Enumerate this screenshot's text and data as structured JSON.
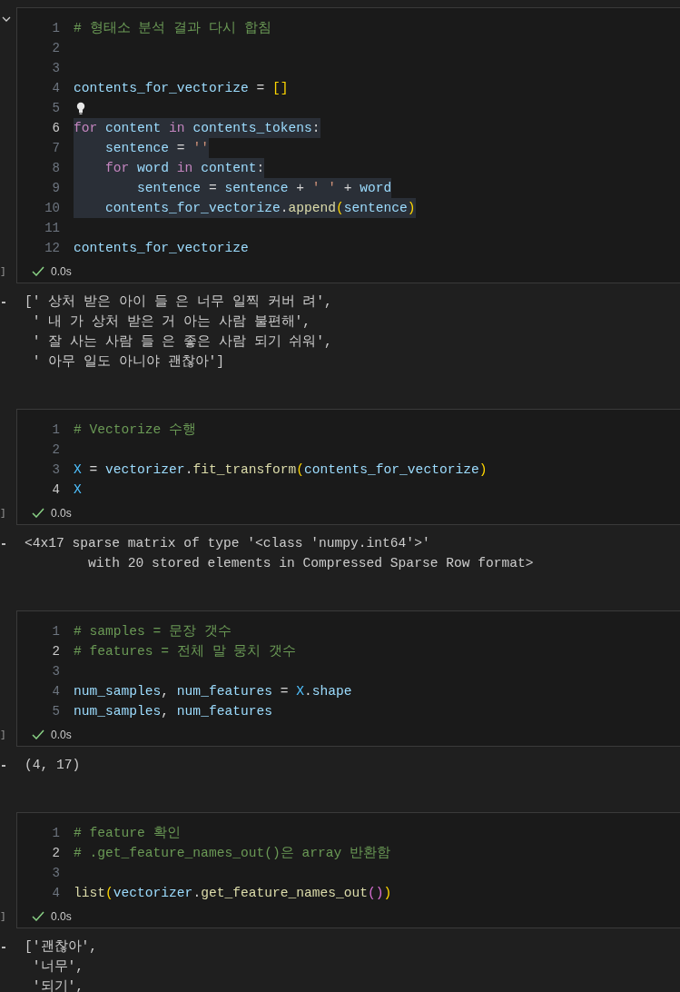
{
  "cells": [
    {
      "execution_label": "]",
      "collapsible": true,
      "status": "0.0s",
      "lines": [
        {
          "number": "1",
          "kind": "code",
          "current": false,
          "highlighted": false,
          "tokens": [
            {
              "kind": "comment",
              "text": "# 형태소 분석 결과 다시 합침"
            }
          ]
        },
        {
          "number": "2",
          "kind": "code",
          "current": false
        },
        {
          "number": "3",
          "kind": "code",
          "current": false
        },
        {
          "number": "4",
          "kind": "code",
          "current": false,
          "highlighted": false,
          "tokens": [
            {
              "kind": "variable",
              "text": "contents_for_vectorize"
            },
            {
              "kind": "operator",
              "text": " = "
            },
            {
              "kind": "bracket",
              "text": "[]"
            }
          ]
        },
        {
          "number": "5",
          "kind": "lightbulb",
          "current": false
        },
        {
          "number": "6",
          "kind": "code",
          "current": true,
          "highlighted": true,
          "tokens": [
            {
              "kind": "keyword",
              "text": "for"
            },
            {
              "kind": "variable",
              "text": " content "
            },
            {
              "kind": "keyword",
              "text": "in"
            },
            {
              "kind": "variable",
              "text": " contents_tokens"
            },
            {
              "kind": "operator",
              "text": ":"
            }
          ]
        },
        {
          "number": "7",
          "kind": "code",
          "current": false,
          "highlighted": true,
          "tokens": [
            {
              "kind": "variable",
              "text": "    sentence"
            },
            {
              "kind": "operator",
              "text": " = "
            },
            {
              "kind": "string",
              "text": "''"
            }
          ]
        },
        {
          "number": "8",
          "kind": "code",
          "current": false,
          "highlighted": true,
          "tokens": [
            {
              "kind": "keyword",
              "text": "    for"
            },
            {
              "kind": "variable",
              "text": " word "
            },
            {
              "kind": "keyword",
              "text": "in"
            },
            {
              "kind": "variable",
              "text": " content"
            },
            {
              "kind": "operator",
              "text": ":"
            }
          ]
        },
        {
          "number": "9",
          "kind": "code",
          "current": false,
          "highlighted": true,
          "tokens": [
            {
              "kind": "variable",
              "text": "        sentence"
            },
            {
              "kind": "operator",
              "text": " = "
            },
            {
              "kind": "variable",
              "text": "sentence"
            },
            {
              "kind": "operator",
              "text": " + "
            },
            {
              "kind": "string",
              "text": "' '"
            },
            {
              "kind": "operator",
              "text": " + "
            },
            {
              "kind": "variable",
              "text": "word"
            }
          ]
        },
        {
          "number": "10",
          "kind": "code",
          "current": false,
          "highlighted": true,
          "tokens": [
            {
              "kind": "variable",
              "text": "    contents_for_vectorize"
            },
            {
              "kind": "operator",
              "text": "."
            },
            {
              "kind": "function",
              "text": "append"
            },
            {
              "kind": "bracket",
              "text": "("
            },
            {
              "kind": "variable",
              "text": "sentence"
            },
            {
              "kind": "bracket",
              "text": ")"
            }
          ]
        },
        {
          "number": "11",
          "kind": "code",
          "current": false
        },
        {
          "number": "12",
          "kind": "code",
          "current": false,
          "highlighted": false,
          "tokens": [
            {
              "kind": "variable",
              "text": "contents_for_vectorize"
            }
          ]
        }
      ],
      "output": [
        "[' 상처 받은 아이 들 은 너무 일찍 커버 려',",
        " ' 내 가 상처 받은 거 아는 사람 불편해',",
        " ' 잘 사는 사람 들 은 좋은 사람 되기 쉬워',",
        " ' 아무 일도 아니야 괜찮아']"
      ]
    },
    {
      "execution_label": "]",
      "collapsible": false,
      "status": "0.0s",
      "lines": [
        {
          "number": "1",
          "kind": "code",
          "current": false,
          "highlighted": false,
          "tokens": [
            {
              "kind": "comment",
              "text": "# Vectorize 수행"
            }
          ]
        },
        {
          "number": "2",
          "kind": "code",
          "current": false
        },
        {
          "number": "3",
          "kind": "code",
          "current": false,
          "highlighted": false,
          "tokens": [
            {
              "kind": "constant",
              "text": "X"
            },
            {
              "kind": "operator",
              "text": " = "
            },
            {
              "kind": "variable",
              "text": "vectorizer"
            },
            {
              "kind": "operator",
              "text": "."
            },
            {
              "kind": "function",
              "text": "fit_transform"
            },
            {
              "kind": "bracket",
              "text": "("
            },
            {
              "kind": "variable",
              "text": "contents_for_vectorize"
            },
            {
              "kind": "bracket",
              "text": ")"
            }
          ]
        },
        {
          "number": "4",
          "kind": "code",
          "current": true,
          "highlighted": false,
          "tokens": [
            {
              "kind": "constant",
              "text": "X"
            }
          ]
        }
      ],
      "output": [
        "<4x17 sparse matrix of type '<class 'numpy.int64'>'",
        "        with 20 stored elements in Compressed Sparse Row format>"
      ]
    },
    {
      "execution_label": "]",
      "collapsible": false,
      "status": "0.0s",
      "lines": [
        {
          "number": "1",
          "kind": "code",
          "current": false,
          "highlighted": false,
          "tokens": [
            {
              "kind": "comment",
              "text": "# samples = 문장 갯수"
            }
          ]
        },
        {
          "number": "2",
          "kind": "code",
          "current": true,
          "highlighted": false,
          "tokens": [
            {
              "kind": "comment",
              "text": "# features = 전체 말 뭉치 갯수"
            }
          ]
        },
        {
          "number": "3",
          "kind": "code",
          "current": false
        },
        {
          "number": "4",
          "kind": "code",
          "current": false,
          "highlighted": false,
          "tokens": [
            {
              "kind": "variable",
              "text": "num_samples"
            },
            {
              "kind": "operator",
              "text": ", "
            },
            {
              "kind": "variable",
              "text": "num_features"
            },
            {
              "kind": "operator",
              "text": " = "
            },
            {
              "kind": "constant",
              "text": "X"
            },
            {
              "kind": "operator",
              "text": "."
            },
            {
              "kind": "variable",
              "text": "shape"
            }
          ]
        },
        {
          "number": "5",
          "kind": "code",
          "current": false,
          "highlighted": false,
          "tokens": [
            {
              "kind": "variable",
              "text": "num_samples"
            },
            {
              "kind": "operator",
              "text": ", "
            },
            {
              "kind": "variable",
              "text": "num_features"
            }
          ]
        }
      ],
      "output": [
        "(4, 17)"
      ]
    },
    {
      "execution_label": "]",
      "collapsible": false,
      "status": "0.0s",
      "lines": [
        {
          "number": "1",
          "kind": "code",
          "current": false,
          "highlighted": false,
          "tokens": [
            {
              "kind": "comment",
              "text": "# feature 확인"
            }
          ]
        },
        {
          "number": "2",
          "kind": "code",
          "current": true,
          "highlighted": false,
          "tokens": [
            {
              "kind": "comment",
              "text": "# .get_feature_names_out()은 array 반환함"
            }
          ]
        },
        {
          "number": "3",
          "kind": "code",
          "current": false
        },
        {
          "number": "4",
          "kind": "code",
          "current": false,
          "highlighted": false,
          "tokens": [
            {
              "kind": "function",
              "text": "list"
            },
            {
              "kind": "bracket",
              "text": "("
            },
            {
              "kind": "variable",
              "text": "vectorizer"
            },
            {
              "kind": "operator",
              "text": "."
            },
            {
              "kind": "function",
              "text": "get_feature_names_out"
            },
            {
              "kind": "bracket2",
              "text": "()"
            },
            {
              "kind": "bracket",
              "text": ")"
            }
          ]
        }
      ],
      "output": [
        "['괜찮아',",
        " '너무',",
        " '되기',"
      ]
    }
  ]
}
